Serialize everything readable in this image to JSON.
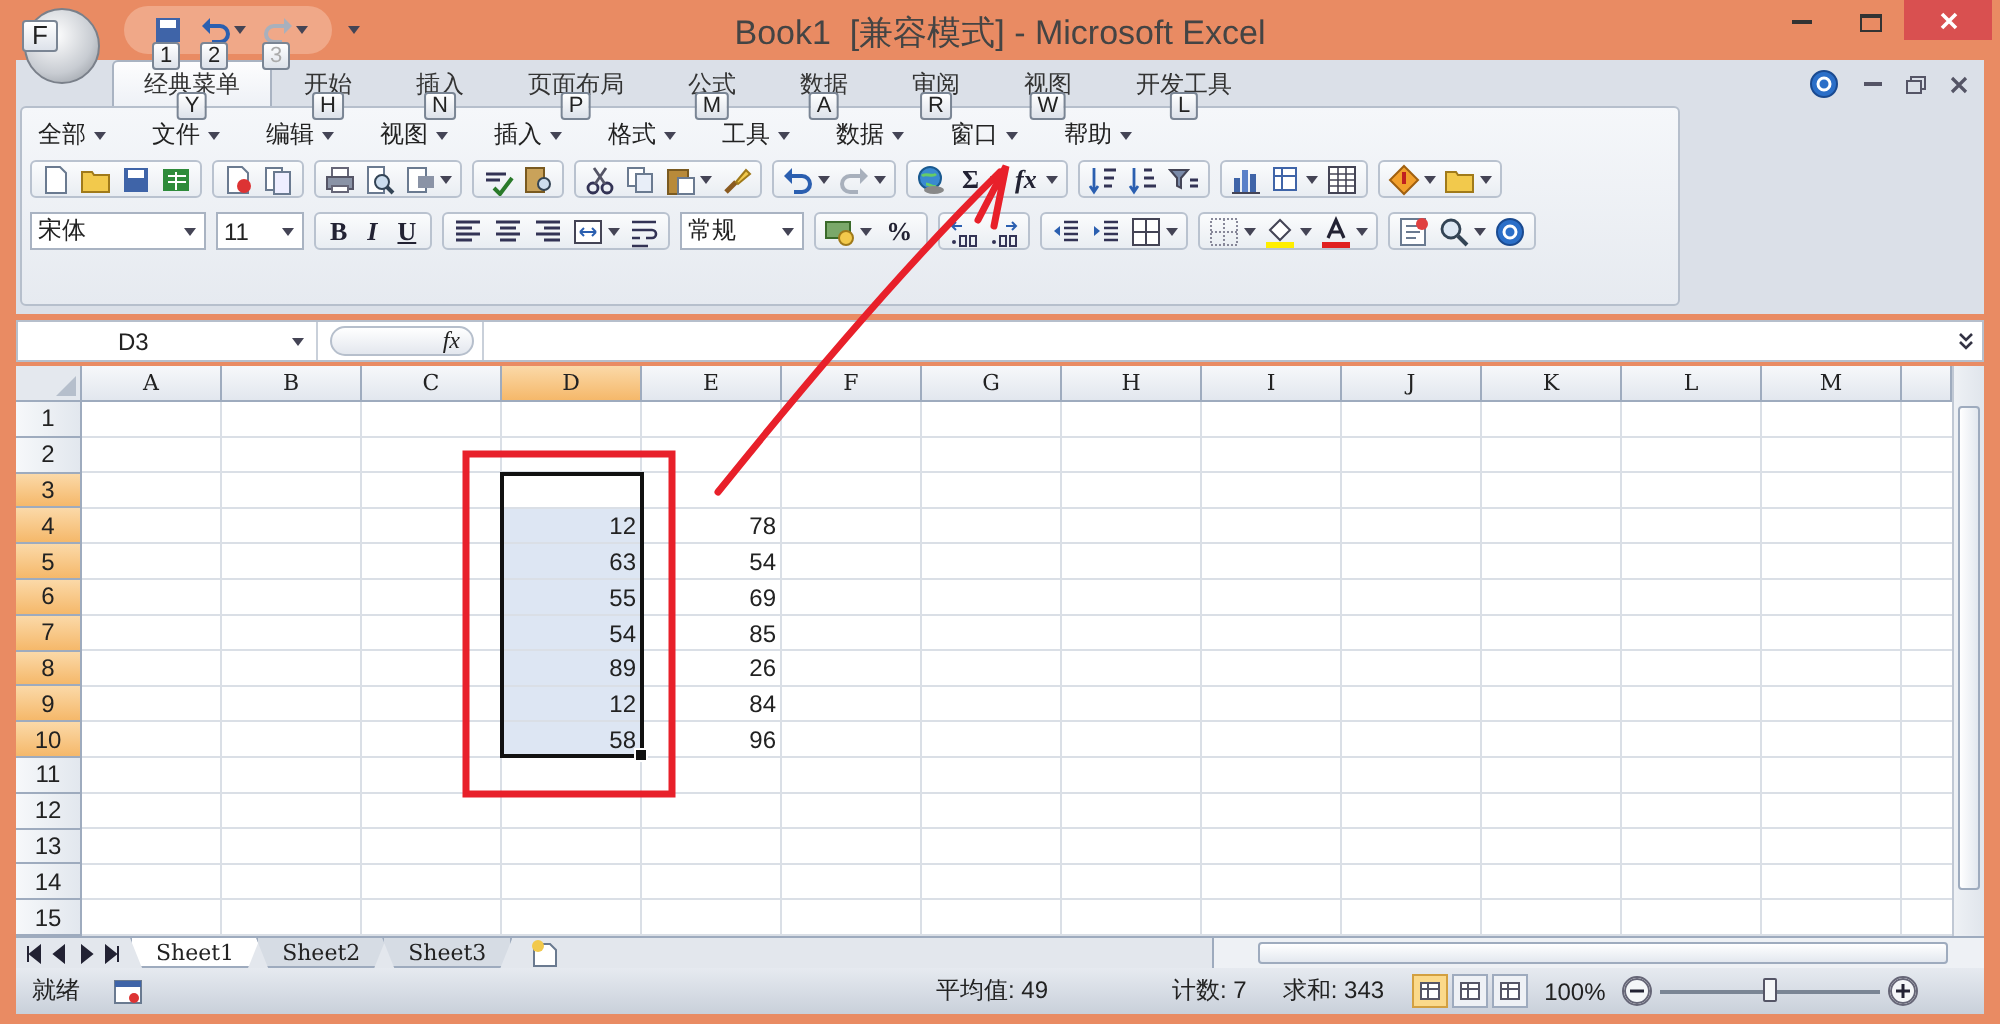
{
  "window": {
    "title": "Book1  [兼容模式] - Microsoft Excel"
  },
  "office_button": {
    "keytip": "F"
  },
  "quick_access": [
    {
      "keytip": "1",
      "disabled": false
    },
    {
      "keytip": "2",
      "disabled": false
    },
    {
      "keytip": "3",
      "disabled": true
    }
  ],
  "ribbon_tabs": [
    {
      "label": "经典菜单",
      "selected": true,
      "keytip": "Y"
    },
    {
      "label": "开始",
      "selected": false,
      "keytip": "H"
    },
    {
      "label": "插入",
      "selected": false,
      "keytip": "N"
    },
    {
      "label": "页面布局",
      "selected": false,
      "keytip": "P"
    },
    {
      "label": "公式",
      "selected": false,
      "keytip": "M"
    },
    {
      "label": "数据",
      "selected": false,
      "keytip": "A"
    },
    {
      "label": "审阅",
      "selected": false,
      "keytip": "R"
    },
    {
      "label": "视图",
      "selected": false,
      "keytip": "W"
    },
    {
      "label": "开发工具",
      "selected": false,
      "keytip": "L"
    }
  ],
  "menus": [
    "全部",
    "文件",
    "编辑",
    "视图",
    "插入",
    "格式",
    "工具",
    "数据",
    "窗口",
    "帮助"
  ],
  "toolbar": {
    "redo": {
      "disabled": true
    },
    "sum": "Σ",
    "function": "fx",
    "font": "宋体",
    "size": "11",
    "bold": "B",
    "italic": "I",
    "underline": "U",
    "number_format": "常规",
    "percent": "%"
  },
  "formula_bar": {
    "name_box": "D3",
    "fx": "fx"
  },
  "columns": [
    {
      "label": "A",
      "selected": false
    },
    {
      "label": "B",
      "selected": false
    },
    {
      "label": "C",
      "selected": false
    },
    {
      "label": "D",
      "selected": true
    },
    {
      "label": "E",
      "selected": false
    },
    {
      "label": "F",
      "selected": false
    },
    {
      "label": "G",
      "selected": false
    },
    {
      "label": "H",
      "selected": false
    },
    {
      "label": "I",
      "selected": false
    },
    {
      "label": "J",
      "selected": false
    },
    {
      "label": "K",
      "selected": false
    },
    {
      "label": "L",
      "selected": false
    },
    {
      "label": "M",
      "selected": false
    }
  ],
  "rows": [
    {
      "header": "1",
      "selected": false
    },
    {
      "header": "2",
      "selected": false
    },
    {
      "header": "3",
      "selected": true,
      "column_d": {
        "selected": true,
        "active": true
      }
    },
    {
      "header": "4",
      "selected": true,
      "column_d": {
        "value": "12",
        "selected": true,
        "active": false
      },
      "column_e": {
        "value": "78"
      }
    },
    {
      "header": "5",
      "selected": true,
      "column_d": {
        "value": "63",
        "selected": true,
        "active": false
      },
      "column_e": {
        "value": "54"
      }
    },
    {
      "header": "6",
      "selected": true,
      "column_d": {
        "value": "55",
        "selected": true,
        "active": false
      },
      "column_e": {
        "value": "69"
      }
    },
    {
      "header": "7",
      "selected": true,
      "column_d": {
        "value": "54",
        "selected": true,
        "active": false
      },
      "column_e": {
        "value": "85"
      }
    },
    {
      "header": "8",
      "selected": true,
      "column_d": {
        "value": "89",
        "selected": true,
        "active": false
      },
      "column_e": {
        "value": "26"
      }
    },
    {
      "header": "9",
      "selected": true,
      "column_d": {
        "value": "12",
        "selected": true,
        "active": false
      },
      "column_e": {
        "value": "84"
      }
    },
    {
      "header": "10",
      "selected": true,
      "column_d": {
        "value": "58",
        "selected": true,
        "active": false
      },
      "column_e": {
        "value": "96"
      }
    },
    {
      "header": "11",
      "selected": false
    },
    {
      "header": "12",
      "selected": false
    },
    {
      "header": "13",
      "selected": false
    },
    {
      "header": "14",
      "selected": false
    },
    {
      "header": "15",
      "selected": false
    }
  ],
  "sheets": [
    {
      "label": "Sheet1",
      "selected": true
    },
    {
      "label": "Sheet2",
      "selected": false
    },
    {
      "label": "Sheet3",
      "selected": false
    }
  ],
  "status_bar": {
    "mode": "就绪",
    "average": "平均值: 49",
    "count": "计数: 7",
    "sum": "求和: 343",
    "view_buttons": [
      {
        "selected": true
      },
      {
        "selected": false
      },
      {
        "selected": false
      }
    ],
    "zoom_percent": "100%",
    "zoom": {
      "level": 0.5
    }
  }
}
